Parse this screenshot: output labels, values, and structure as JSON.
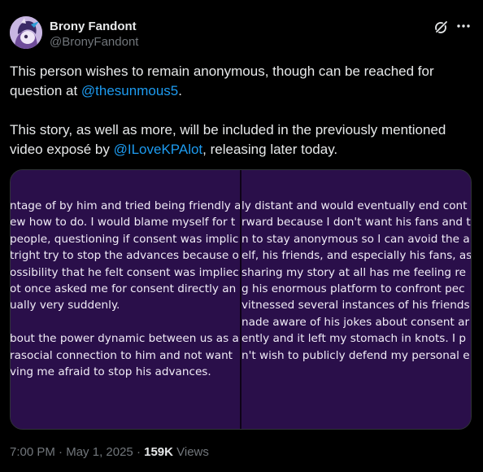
{
  "author": {
    "name": "Brony Fandont",
    "handle": "@BronyFandont"
  },
  "icons": {
    "avatar": "pony-avatar",
    "grok": "grok-icon",
    "more": "more-icon"
  },
  "post": {
    "p1_text": "This person wishes to remain anonymous, though can be reached for question at ",
    "p1_mention": "@thesunmous5",
    "p1_end": ".",
    "p2_text": "This story, as well as more, will be included in the previously mentioned video exposé by ",
    "p2_mention": "@ILoveKPAlot",
    "p2_end": ", releasing later today."
  },
  "media": {
    "left_lines": [
      "ntage of by him and tried being friendly a",
      "ew how to do. I would blame myself for t",
      "people, questioning if consent was implic",
      "tright try to stop the advances because o",
      "ossibility that he felt consent was impliec",
      "ot once asked me for consent directly an",
      "ually very suddenly.",
      "",
      "bout the power dynamic between us as a",
      "rasocial connection to him and not want",
      "ving me afraid to stop his advances."
    ],
    "right_lines": [
      "ly distant and would eventually end cont",
      "rward because I don't want his fans and t",
      "n to stay anonymous so I can avoid the a",
      "elf, his friends, and especially his fans, as",
      " sharing my story at all has me feeling re",
      "g his enormous platform to confront pec",
      "vitnessed several instances of his friends",
      "nade aware of his jokes about consent ar",
      "ently and it left my stomach in knots. I p",
      "n't wish to publicly defend my personal e"
    ],
    "colors": {
      "background": "#2a0f4a",
      "text": "#f1ecf7"
    }
  },
  "meta": {
    "time": "7:00 PM",
    "separator": " · ",
    "date": "May 1, 2025",
    "views_count": "159K",
    "views_label": " Views"
  },
  "colors": {
    "accent": "#1d9bf0",
    "background": "#000000",
    "muted": "#71767b",
    "text": "#e7e9ea"
  }
}
